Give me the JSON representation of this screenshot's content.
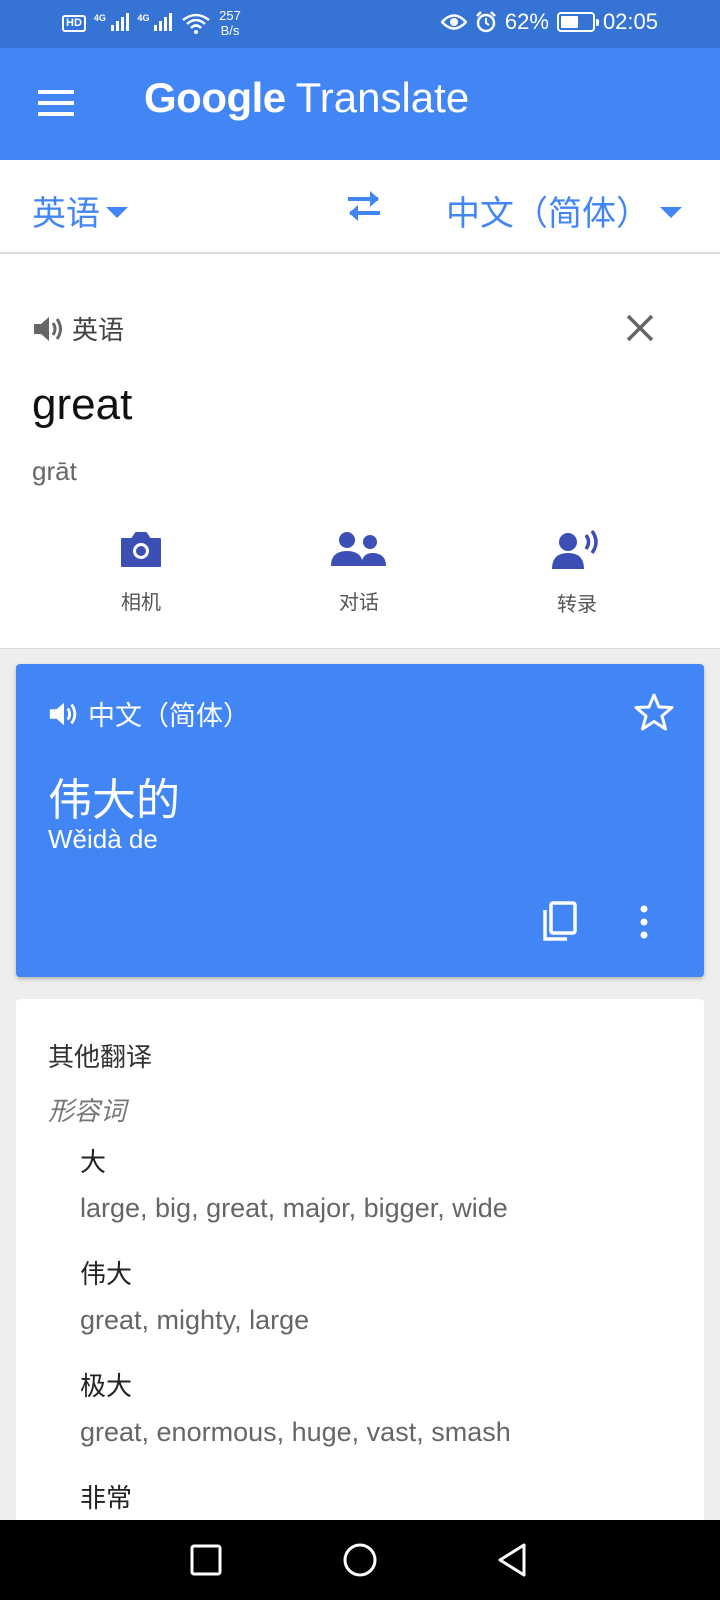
{
  "status_bar": {
    "hd": "HD",
    "net1": "4G",
    "net2": "4G",
    "speed_value": "257",
    "speed_unit": "B/s",
    "battery": "62%",
    "battery_level": 0.62,
    "time": "02:05",
    "icons": [
      "signal-icon",
      "wifi-icon",
      "eye-icon",
      "alarm-icon",
      "battery-icon"
    ]
  },
  "app_bar": {
    "brand": "Google",
    "product": "Translate"
  },
  "language_bar": {
    "source": "英语",
    "target": "中文（简体）"
  },
  "input": {
    "language": "英语",
    "text": "great",
    "transliteration": "grāt"
  },
  "tools": [
    {
      "label": "相机",
      "icon": "camera-icon"
    },
    {
      "label": "对话",
      "icon": "conversation-icon"
    },
    {
      "label": "转录",
      "icon": "transcribe-icon"
    }
  ],
  "result": {
    "language": "中文（简体）",
    "text": "伟大的",
    "transliteration": "Wěidà de"
  },
  "other_translations": {
    "title": "其他翻译",
    "part_of_speech": "形容词",
    "entries": [
      {
        "word": "大",
        "synonyms": "large, big, great, major, bigger, wide"
      },
      {
        "word": "伟大",
        "synonyms": "great, mighty, large"
      },
      {
        "word": "极大",
        "synonyms": "great, enormous, huge, vast, smash"
      },
      {
        "word": "非常",
        "synonyms": ""
      }
    ]
  },
  "colors": {
    "status_bar": "#3574d4",
    "app_bar": "#4285f4",
    "accent": "#4285f4",
    "tool_icon": "#3c4fb5"
  }
}
